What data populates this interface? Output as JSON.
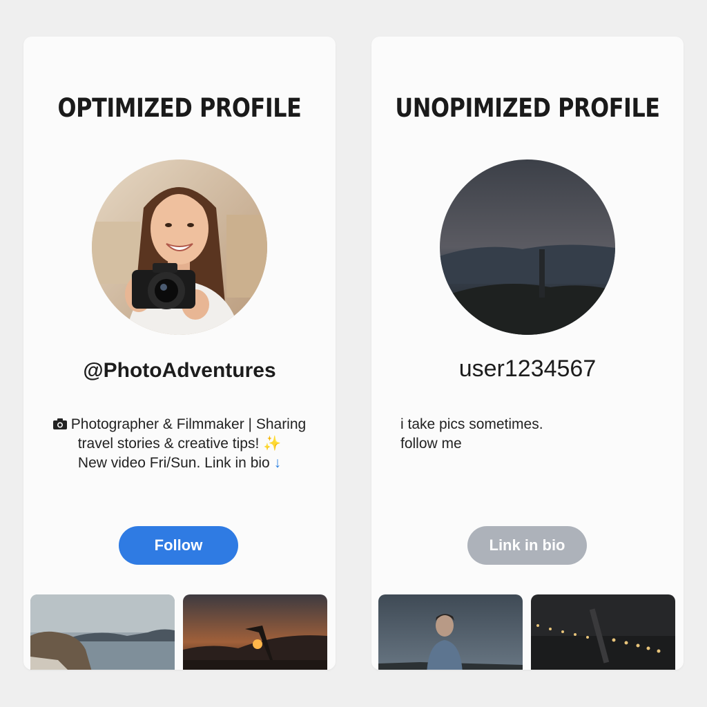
{
  "colors": {
    "follow_button": "#2f7be3",
    "link_button": "#adb2ba",
    "page_background": "#efefef",
    "card_background": "#fbfbfb"
  },
  "optimized": {
    "title": "OPTIMIZED PROFILE",
    "handle": "@PhotoAdventures",
    "bio_icon": "camera-icon",
    "bio": {
      "line1": "Photographer & Filmmaker | Sharing",
      "line2": "travel stories & creative tips!",
      "line2_emoji": "✨",
      "line3": "New video Fri/Sun. Link in bio",
      "line3_emoji": "↓"
    },
    "button_label": "Follow"
  },
  "unoptimized": {
    "title": "UNOPIMIZED PROFILE",
    "handle": "user1234567",
    "bio": {
      "line1": "i take pics sometimes.",
      "line2": "follow me"
    },
    "button_label": "Link in bio"
  }
}
